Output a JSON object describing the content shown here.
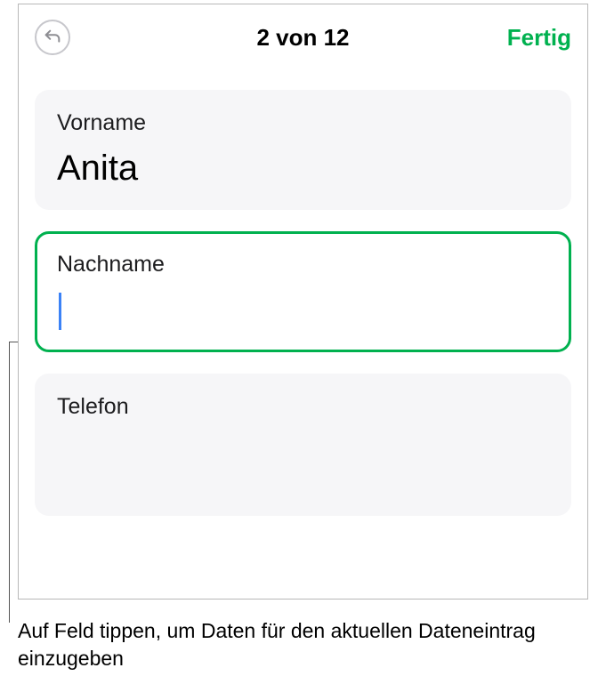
{
  "header": {
    "title": "2 von 12",
    "done_label": "Fertig"
  },
  "form": {
    "vorname": {
      "label": "Vorname",
      "value": "Anita"
    },
    "nachname": {
      "label": "Nachname",
      "value": ""
    },
    "telefon": {
      "label": "Telefon",
      "value": ""
    }
  },
  "caption": "Auf Feld tippen, um Daten für den aktuellen Dateneintrag einzugeben"
}
